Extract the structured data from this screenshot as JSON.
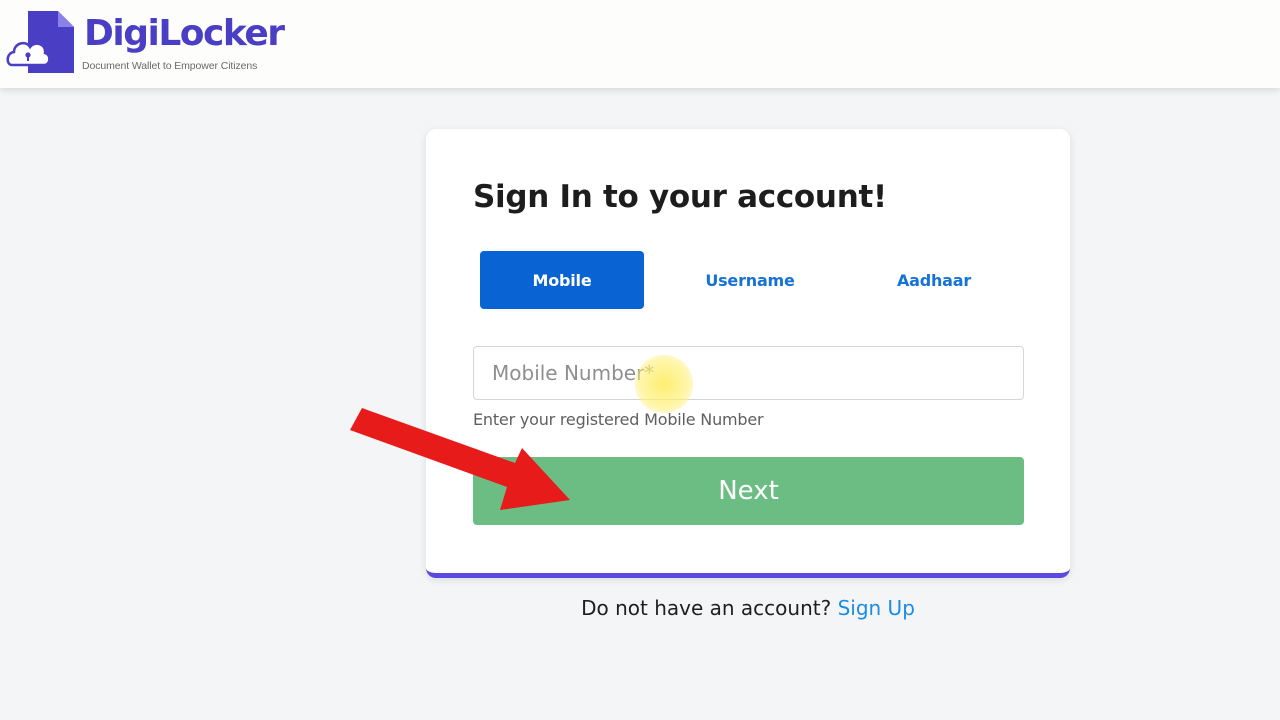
{
  "header": {
    "brand_name": "DigiLocker",
    "tagline": "Document Wallet to Empower Citizens",
    "logo_icon": "cloud-lock-document-icon"
  },
  "signin": {
    "title": "Sign In to your account!",
    "tabs": [
      {
        "label": "Mobile",
        "selected": true
      },
      {
        "label": "Username",
        "selected": false
      },
      {
        "label": "Aadhaar",
        "selected": false
      }
    ],
    "mobile_field": {
      "placeholder": "Mobile Number*",
      "value": "",
      "helper": "Enter your registered Mobile Number"
    },
    "next_label": "Next"
  },
  "footer": {
    "prompt": "Do not have an account?",
    "signup_label": "Sign Up"
  },
  "colors": {
    "brand": "#4a3fc4",
    "active_tab": "#0a63d3",
    "tab_text": "#1672d6",
    "next_button": "#6cbd84",
    "card_accent": "#5b4ae0",
    "link": "#1b8be6",
    "annotation_arrow": "#e81b1b"
  },
  "annotation": {
    "arrow_icon": "red-arrow-icon",
    "cursor": "yellow-cursor-highlight"
  }
}
